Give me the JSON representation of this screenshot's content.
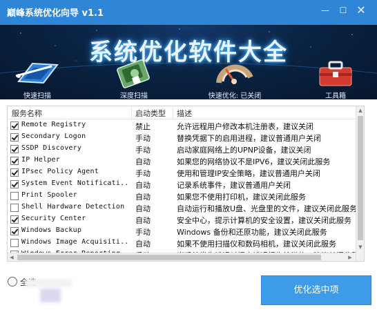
{
  "window": {
    "title": "巅峰系统优化向导 v1.1",
    "min_icon": "minimize-icon",
    "max_icon": "maximize-icon",
    "close_icon": "close-icon"
  },
  "banner": {
    "title": "系统优化软件大全",
    "tools": [
      {
        "label": "快速扫描",
        "icon": "scan-icon"
      },
      {
        "label": "深度扫描",
        "icon": "hdd-icon"
      },
      {
        "label": "快速优化: 已关闭",
        "icon": "gauge-icon"
      },
      {
        "label": "工具箱",
        "icon": "toolbox-icon"
      }
    ]
  },
  "list": {
    "headers": {
      "name": "服务名称",
      "type": "启动类型",
      "desc": "描述"
    },
    "rows": [
      {
        "checked": true,
        "name": "Remote Registry",
        "type": "禁止",
        "desc": "允许远程用户修改本机注册表，建议关闭"
      },
      {
        "checked": true,
        "name": "Secondary Logon",
        "type": "手动",
        "desc": "替换凭据下的启用进程，建议普通用户关闭"
      },
      {
        "checked": true,
        "name": "SSDP Discovery",
        "type": "手动",
        "desc": "启动家庭网络上的UPNP设备，建议关闭"
      },
      {
        "checked": true,
        "name": "IP Helper",
        "type": "自动",
        "desc": "如果您的网络协议不是IPV6，建议关闭此服务"
      },
      {
        "checked": true,
        "name": "IPsec Policy Agent",
        "type": "手动",
        "desc": "使用和管理IP安全策略，建议普通用户关闭"
      },
      {
        "checked": true,
        "name": "System Event Notificati...",
        "type": "自动",
        "desc": "记录系统事件，建议普通用户关闭"
      },
      {
        "checked": false,
        "name": "Print Spooler",
        "type": "自动",
        "desc": "如果您不使用打印机，建议关闭此服务"
      },
      {
        "checked": false,
        "name": "Shell Hardware Detection",
        "type": "自动",
        "desc": "自动运行和播放U盘、光盘里的文件，建议关闭此服务"
      },
      {
        "checked": true,
        "name": "Security Center",
        "type": "自动",
        "desc": "安全中心，提示计算机的安全设置，建议关闭此服务"
      },
      {
        "checked": true,
        "name": "Windows Backup",
        "type": "手动",
        "desc": "Windows 备份和还原功能，建议关闭此服务"
      },
      {
        "checked": false,
        "name": "Windows Image Acquisiti...",
        "type": "自动",
        "desc": "如果不使用扫描仪和数码相机，建议关闭此服务"
      },
      {
        "checked": true,
        "name": "Windows Error Reporting...",
        "type": "手动",
        "desc": "当系统发生错误时提交错误报告给微软，建议关闭此服务"
      }
    ]
  },
  "footer": {
    "select_all": "全选",
    "optimize_button": "优化选中项"
  },
  "colors": {
    "titlebar": "#2f86d6",
    "button": "#3d9be8"
  }
}
